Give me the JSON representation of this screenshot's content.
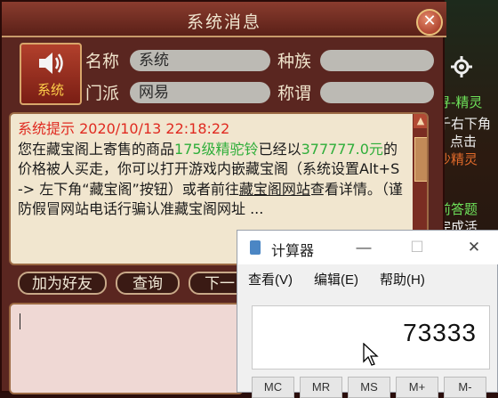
{
  "dialog": {
    "title": "系统消息",
    "close": "✕",
    "avatar_label": "系统",
    "fields": {
      "name_label": "名称",
      "name_value": "系统",
      "race_label": "种族",
      "race_value": "",
      "sect_label": "门派",
      "sect_value": "网易",
      "title_label": "称谓",
      "title_value": ""
    },
    "message": {
      "header": "系统提示 2020/10/13 22:18:22",
      "p1": "您在藏宝阁上寄售的商品",
      "item": "175级精驼铃",
      "p2": "已经以",
      "price": "377777.0元",
      "p3": "的价格被人买走，你可以打开游戏内嵌藏宝阁（系统设置Alt+S -> 左下角“藏宝阁”按钮）或者前往",
      "link": "藏宝阁网站",
      "p4": "查看详情。（谨防假冒网站电话行骗认准藏宝阁网址 ..."
    },
    "buttons": {
      "add_friend": "加为好友",
      "query": "查询",
      "next": "下一"
    }
  },
  "game_bg": {
    "t1": "寻-精灵",
    "t2": "千右下角",
    "t3": "点击",
    "t4": "沙精灵",
    "t5": "前答题",
    "t6": "完成活"
  },
  "calculator": {
    "title": "计算器",
    "menu": [
      "查看(V)",
      "编辑(E)",
      "帮助(H)"
    ],
    "display": "73333",
    "keys": [
      "MC",
      "MR",
      "MS",
      "M+",
      "M-"
    ],
    "minimize": "—",
    "maximize": "☐",
    "close": "✕"
  }
}
